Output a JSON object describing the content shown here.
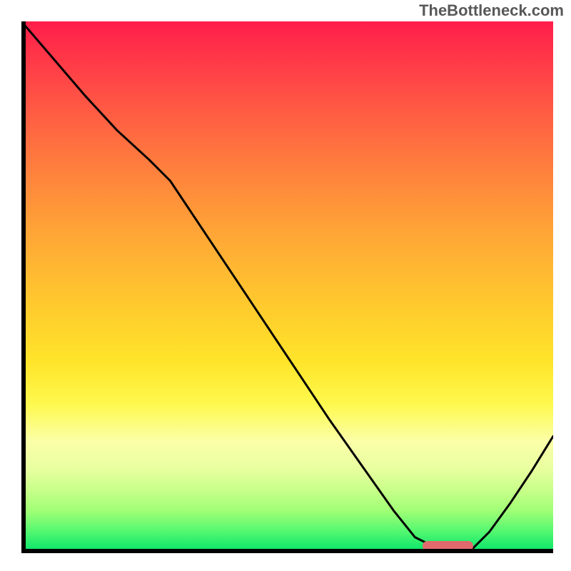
{
  "attribution": "TheBottleneck.com",
  "colors": {
    "attribution_text": "#585858",
    "axis": "#000000",
    "curve": "#000000",
    "marker": "#e06a6e",
    "gradient_stops": [
      "#ff1e4a",
      "#ff4a46",
      "#ff7a3e",
      "#ffa636",
      "#ffc92e",
      "#ffe42a",
      "#fef94e",
      "#fbffa8",
      "#e9ffa0",
      "#c9ff8a",
      "#a1ff76",
      "#52f770",
      "#00e36a"
    ]
  },
  "marker": {
    "x_frac": 0.755,
    "width_frac": 0.095,
    "y_frac": 0.986
  },
  "chart_data": {
    "type": "line",
    "title": "",
    "xlabel": "",
    "ylabel": "",
    "xlim": [
      0,
      1
    ],
    "ylim": [
      0,
      1
    ],
    "legend": false,
    "grid": false,
    "axes_shown": [
      "left",
      "bottom"
    ],
    "annotations": [
      {
        "text": "TheBottleneck.com",
        "position": "top-right"
      }
    ],
    "series": [
      {
        "name": "bottleneck-curve",
        "comment": "x and y are normalized fractions of the plot area (0..1, origin bottom-left). y=1 is top, y=0 is bottom. Values estimated from pixel positions; no numeric axis ticks are shown.",
        "x": [
          0.0,
          0.06,
          0.12,
          0.18,
          0.24,
          0.28,
          0.34,
          0.4,
          0.46,
          0.52,
          0.58,
          0.64,
          0.7,
          0.74,
          0.78,
          0.82,
          0.85,
          0.88,
          0.92,
          0.96,
          1.0
        ],
        "y": [
          1.0,
          0.93,
          0.86,
          0.795,
          0.74,
          0.7,
          0.61,
          0.52,
          0.43,
          0.34,
          0.25,
          0.165,
          0.08,
          0.03,
          0.01,
          0.01,
          0.01,
          0.04,
          0.095,
          0.155,
          0.22
        ]
      }
    ],
    "background": {
      "type": "vertical-gradient",
      "stops_pct": [
        {
          "pct": 0,
          "color": "#ff1e4a"
        },
        {
          "pct": 12,
          "color": "#ff4a46"
        },
        {
          "pct": 26,
          "color": "#ff7a3e"
        },
        {
          "pct": 40,
          "color": "#ffa636"
        },
        {
          "pct": 53,
          "color": "#ffc92e"
        },
        {
          "pct": 64,
          "color": "#ffe42a"
        },
        {
          "pct": 72,
          "color": "#fef94e"
        },
        {
          "pct": 79,
          "color": "#fbffa8"
        },
        {
          "pct": 84,
          "color": "#e9ffa0"
        },
        {
          "pct": 88,
          "color": "#c9ff8a"
        },
        {
          "pct": 92,
          "color": "#a1ff76"
        },
        {
          "pct": 96,
          "color": "#52f770"
        },
        {
          "pct": 100,
          "color": "#00e36a"
        }
      ]
    },
    "marker_region": {
      "comment": "pink rounded bar along the x-axis indicating optimal range",
      "x_start_frac": 0.755,
      "x_end_frac": 0.85,
      "y_frac": 0.014
    }
  }
}
